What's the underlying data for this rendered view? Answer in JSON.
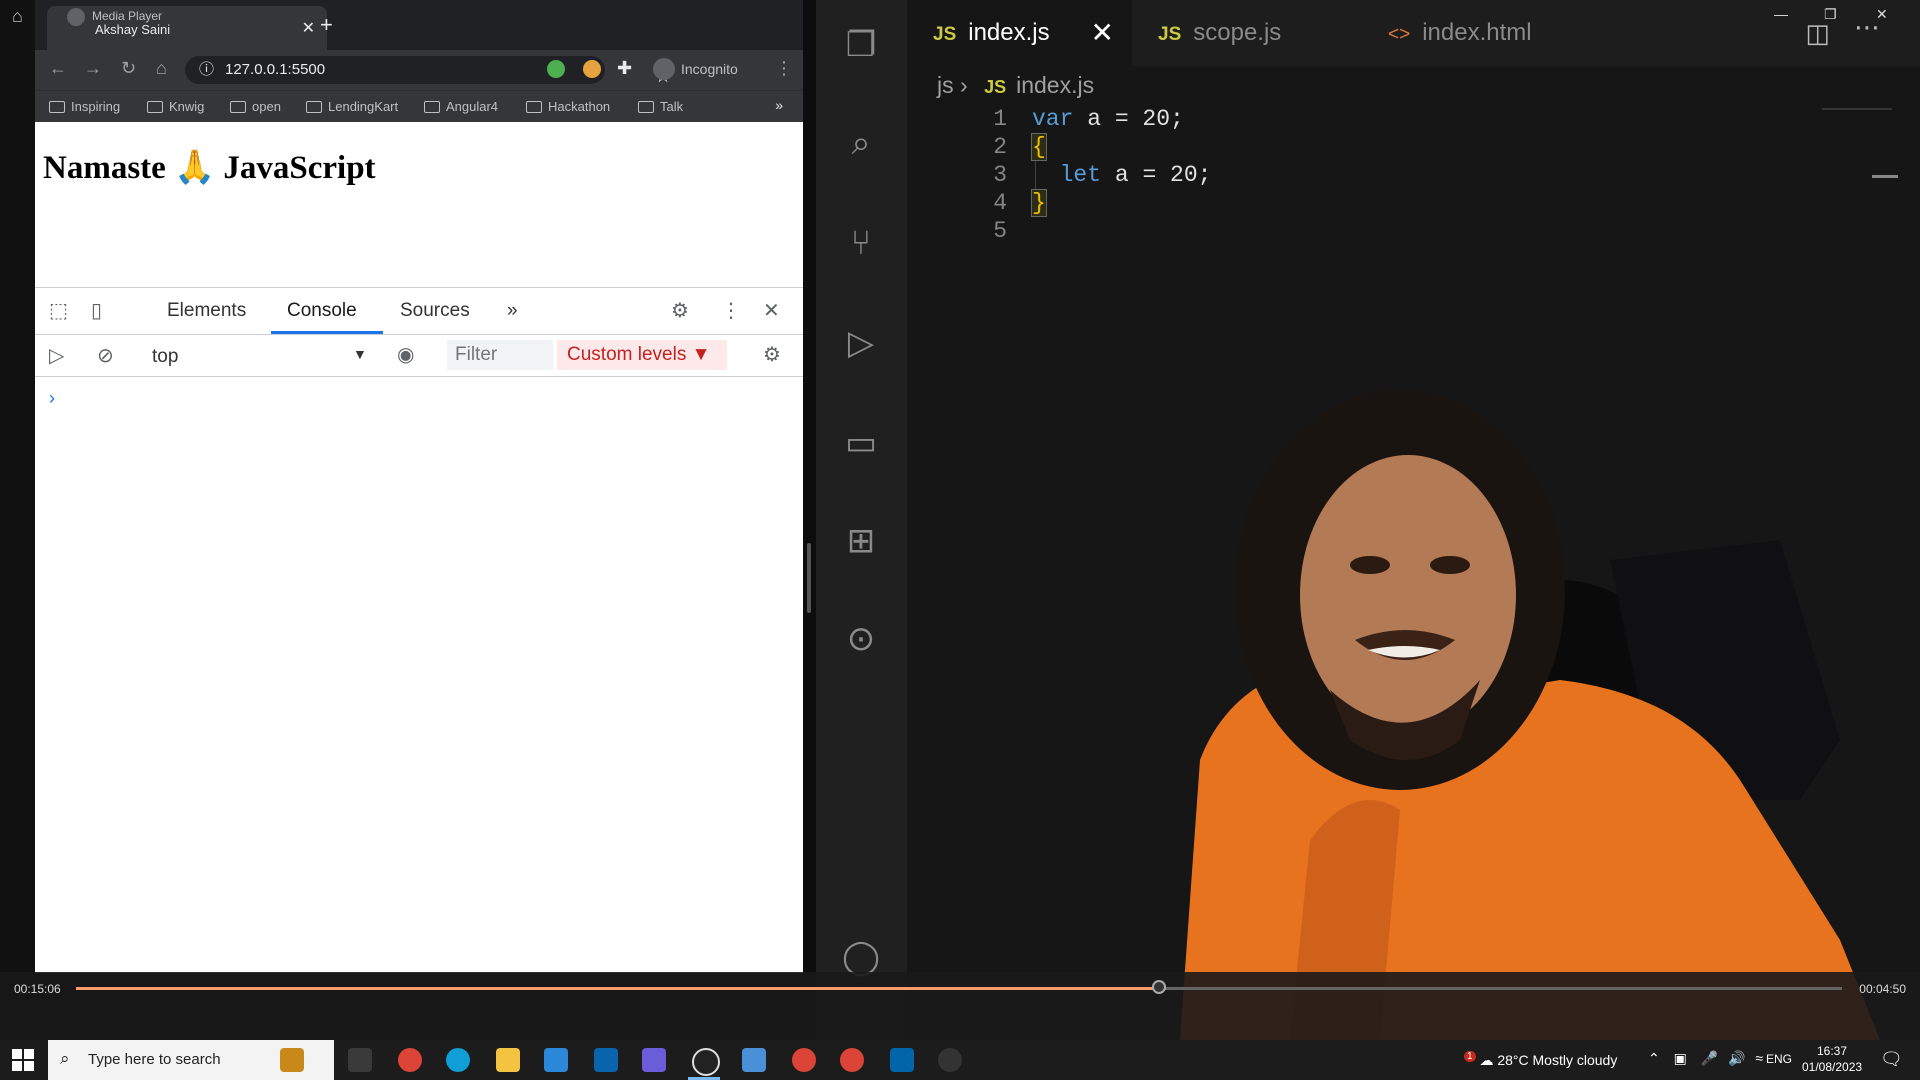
{
  "player": {
    "title": "Media Player",
    "subtitle": "Akshay Saini"
  },
  "browser": {
    "url": "127.0.0.1:5500",
    "profile": "Incognito",
    "bookmarks": [
      "Inspiring",
      "Knwig",
      "open",
      "LendingKart",
      "Angular4",
      "Hackathon",
      "Talk"
    ],
    "page_heading": "Namaste 🙏 JavaScript"
  },
  "devtools": {
    "tabs": [
      "Elements",
      "Console",
      "Sources"
    ],
    "more_tabs": "»",
    "context": "top",
    "filter_placeholder": "Filter",
    "levels": "Custom levels ▼",
    "prompt": "›"
  },
  "vscode": {
    "tabs": [
      {
        "label": "index.js",
        "kind": "JS"
      },
      {
        "label": "scope.js",
        "kind": "JS"
      },
      {
        "label": "index.html",
        "kind": "html"
      }
    ],
    "breadcrumb": {
      "folder": "js",
      "file": "index.js"
    },
    "lines": [
      "1",
      "2",
      "3",
      "4",
      "5"
    ]
  },
  "seek": {
    "elapsed": "00:15:06",
    "total": "00:04:50",
    "progress": 0.613
  },
  "taskbar": {
    "search_placeholder": "Type here to search",
    "weather_temp": "28°C",
    "weather_text": "Mostly cloudy",
    "weather_badge": "1",
    "lang": "ENG",
    "time": "16:37",
    "date": "01/08/2023"
  }
}
